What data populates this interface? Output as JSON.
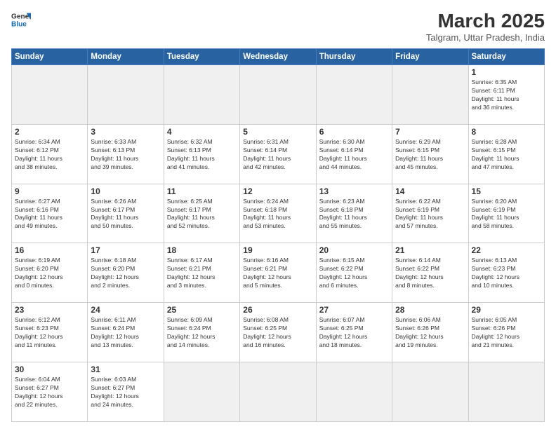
{
  "header": {
    "logo_general": "General",
    "logo_blue": "Blue",
    "title": "March 2025",
    "subtitle": "Talgram, Uttar Pradesh, India"
  },
  "weekdays": [
    "Sunday",
    "Monday",
    "Tuesday",
    "Wednesday",
    "Thursday",
    "Friday",
    "Saturday"
  ],
  "weeks": [
    [
      {
        "day": "",
        "info": "",
        "empty": true
      },
      {
        "day": "",
        "info": "",
        "empty": true
      },
      {
        "day": "",
        "info": "",
        "empty": true
      },
      {
        "day": "",
        "info": "",
        "empty": true
      },
      {
        "day": "",
        "info": "",
        "empty": true
      },
      {
        "day": "",
        "info": "",
        "empty": true
      },
      {
        "day": "1",
        "info": "Sunrise: 6:35 AM\nSunset: 6:11 PM\nDaylight: 11 hours\nand 36 minutes.",
        "empty": false
      }
    ],
    [
      {
        "day": "2",
        "info": "Sunrise: 6:34 AM\nSunset: 6:12 PM\nDaylight: 11 hours\nand 38 minutes.",
        "empty": false
      },
      {
        "day": "3",
        "info": "Sunrise: 6:33 AM\nSunset: 6:13 PM\nDaylight: 11 hours\nand 39 minutes.",
        "empty": false
      },
      {
        "day": "4",
        "info": "Sunrise: 6:32 AM\nSunset: 6:13 PM\nDaylight: 11 hours\nand 41 minutes.",
        "empty": false
      },
      {
        "day": "5",
        "info": "Sunrise: 6:31 AM\nSunset: 6:14 PM\nDaylight: 11 hours\nand 42 minutes.",
        "empty": false
      },
      {
        "day": "6",
        "info": "Sunrise: 6:30 AM\nSunset: 6:14 PM\nDaylight: 11 hours\nand 44 minutes.",
        "empty": false
      },
      {
        "day": "7",
        "info": "Sunrise: 6:29 AM\nSunset: 6:15 PM\nDaylight: 11 hours\nand 45 minutes.",
        "empty": false
      },
      {
        "day": "8",
        "info": "Sunrise: 6:28 AM\nSunset: 6:15 PM\nDaylight: 11 hours\nand 47 minutes.",
        "empty": false
      }
    ],
    [
      {
        "day": "9",
        "info": "Sunrise: 6:27 AM\nSunset: 6:16 PM\nDaylight: 11 hours\nand 49 minutes.",
        "empty": false
      },
      {
        "day": "10",
        "info": "Sunrise: 6:26 AM\nSunset: 6:17 PM\nDaylight: 11 hours\nand 50 minutes.",
        "empty": false
      },
      {
        "day": "11",
        "info": "Sunrise: 6:25 AM\nSunset: 6:17 PM\nDaylight: 11 hours\nand 52 minutes.",
        "empty": false
      },
      {
        "day": "12",
        "info": "Sunrise: 6:24 AM\nSunset: 6:18 PM\nDaylight: 11 hours\nand 53 minutes.",
        "empty": false
      },
      {
        "day": "13",
        "info": "Sunrise: 6:23 AM\nSunset: 6:18 PM\nDaylight: 11 hours\nand 55 minutes.",
        "empty": false
      },
      {
        "day": "14",
        "info": "Sunrise: 6:22 AM\nSunset: 6:19 PM\nDaylight: 11 hours\nand 57 minutes.",
        "empty": false
      },
      {
        "day": "15",
        "info": "Sunrise: 6:20 AM\nSunset: 6:19 PM\nDaylight: 11 hours\nand 58 minutes.",
        "empty": false
      }
    ],
    [
      {
        "day": "16",
        "info": "Sunrise: 6:19 AM\nSunset: 6:20 PM\nDaylight: 12 hours\nand 0 minutes.",
        "empty": false
      },
      {
        "day": "17",
        "info": "Sunrise: 6:18 AM\nSunset: 6:20 PM\nDaylight: 12 hours\nand 2 minutes.",
        "empty": false
      },
      {
        "day": "18",
        "info": "Sunrise: 6:17 AM\nSunset: 6:21 PM\nDaylight: 12 hours\nand 3 minutes.",
        "empty": false
      },
      {
        "day": "19",
        "info": "Sunrise: 6:16 AM\nSunset: 6:21 PM\nDaylight: 12 hours\nand 5 minutes.",
        "empty": false
      },
      {
        "day": "20",
        "info": "Sunrise: 6:15 AM\nSunset: 6:22 PM\nDaylight: 12 hours\nand 6 minutes.",
        "empty": false
      },
      {
        "day": "21",
        "info": "Sunrise: 6:14 AM\nSunset: 6:22 PM\nDaylight: 12 hours\nand 8 minutes.",
        "empty": false
      },
      {
        "day": "22",
        "info": "Sunrise: 6:13 AM\nSunset: 6:23 PM\nDaylight: 12 hours\nand 10 minutes.",
        "empty": false
      }
    ],
    [
      {
        "day": "23",
        "info": "Sunrise: 6:12 AM\nSunset: 6:23 PM\nDaylight: 12 hours\nand 11 minutes.",
        "empty": false
      },
      {
        "day": "24",
        "info": "Sunrise: 6:11 AM\nSunset: 6:24 PM\nDaylight: 12 hours\nand 13 minutes.",
        "empty": false
      },
      {
        "day": "25",
        "info": "Sunrise: 6:09 AM\nSunset: 6:24 PM\nDaylight: 12 hours\nand 14 minutes.",
        "empty": false
      },
      {
        "day": "26",
        "info": "Sunrise: 6:08 AM\nSunset: 6:25 PM\nDaylight: 12 hours\nand 16 minutes.",
        "empty": false
      },
      {
        "day": "27",
        "info": "Sunrise: 6:07 AM\nSunset: 6:25 PM\nDaylight: 12 hours\nand 18 minutes.",
        "empty": false
      },
      {
        "day": "28",
        "info": "Sunrise: 6:06 AM\nSunset: 6:26 PM\nDaylight: 12 hours\nand 19 minutes.",
        "empty": false
      },
      {
        "day": "29",
        "info": "Sunrise: 6:05 AM\nSunset: 6:26 PM\nDaylight: 12 hours\nand 21 minutes.",
        "empty": false
      }
    ],
    [
      {
        "day": "30",
        "info": "Sunrise: 6:04 AM\nSunset: 6:27 PM\nDaylight: 12 hours\nand 22 minutes.",
        "empty": false
      },
      {
        "day": "31",
        "info": "Sunrise: 6:03 AM\nSunset: 6:27 PM\nDaylight: 12 hours\nand 24 minutes.",
        "empty": false
      },
      {
        "day": "",
        "info": "",
        "empty": true
      },
      {
        "day": "",
        "info": "",
        "empty": true
      },
      {
        "day": "",
        "info": "",
        "empty": true
      },
      {
        "day": "",
        "info": "",
        "empty": true
      },
      {
        "day": "",
        "info": "",
        "empty": true
      }
    ]
  ]
}
